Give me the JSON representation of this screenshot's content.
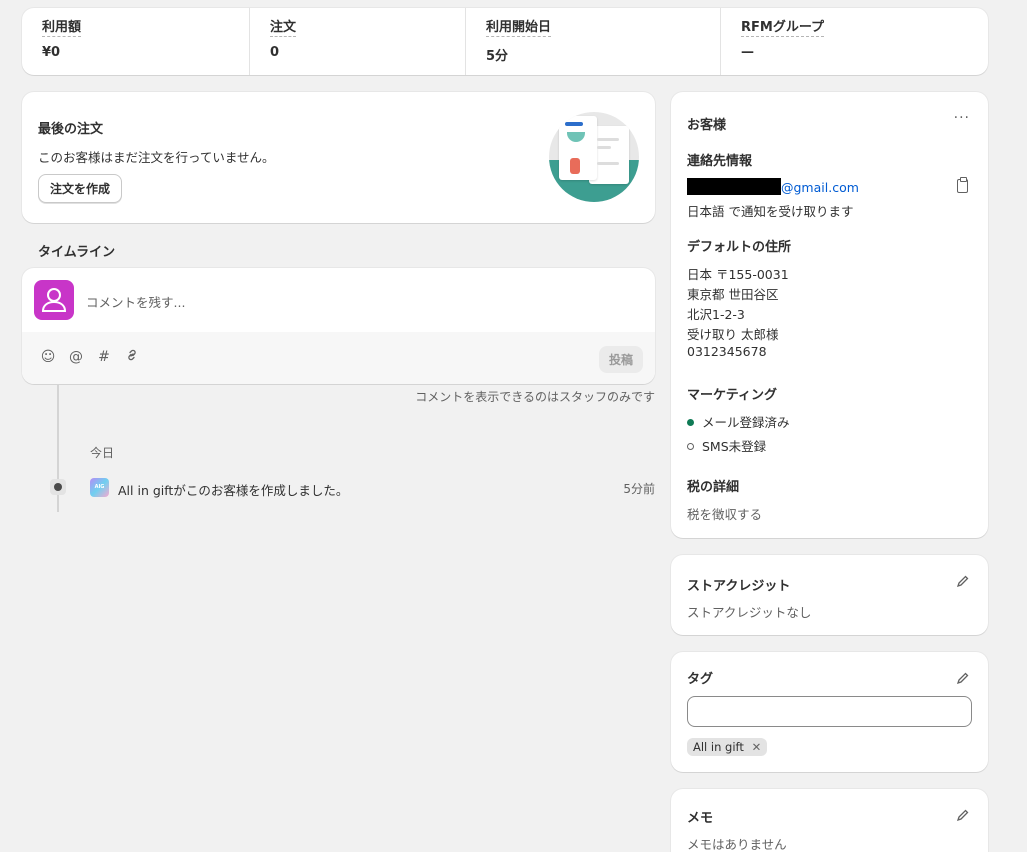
{
  "stats": [
    {
      "label": "利用額",
      "value": "¥0"
    },
    {
      "label": "注文",
      "value": "0"
    },
    {
      "label": "利用開始日",
      "value": "5分"
    },
    {
      "label": "RFMグループ",
      "value": "—"
    }
  ],
  "last_order": {
    "title": "最後の注文",
    "description": "このお客様はまだ注文を行っていません。",
    "create_button": "注文を作成"
  },
  "timeline": {
    "title": "タイムライン",
    "comment_placeholder": "コメントを残す...",
    "post_button": "投稿",
    "staff_note": "コメントを表示できるのはスタッフのみです",
    "group_label": "今日",
    "event": {
      "app_icon_text": "All in gift",
      "text": "All in giftがこのお客様を作成しました。",
      "time": "5分前"
    }
  },
  "customer": {
    "title": "お客様",
    "contact_heading": "連絡先情報",
    "email_suffix": "@gmail.com",
    "notify_language": "日本語 で通知を受け取ります",
    "address_heading": "デフォルトの住所",
    "address_lines": [
      "日本 〒155-0031",
      "東京都 世田谷区",
      "北沢1-2-3",
      "受け取り 太郎様",
      "0312345678"
    ],
    "marketing_heading": "マーケティング",
    "marketing_email": "メール登録済み",
    "marketing_sms": "SMS未登録",
    "tax_heading": "税の詳細",
    "tax_value": "税を徴収する"
  },
  "store_credit": {
    "title": "ストアクレジット",
    "value": "ストアクレジットなし"
  },
  "tags": {
    "title": "タグ",
    "chips": [
      "All in gift"
    ]
  },
  "memo": {
    "title": "メモ",
    "value": "メモはありません"
  },
  "colors": {
    "accent_link": "#005bd3",
    "subscribed_green": "#0f7a55",
    "avatar_magenta": "#c835c8"
  }
}
